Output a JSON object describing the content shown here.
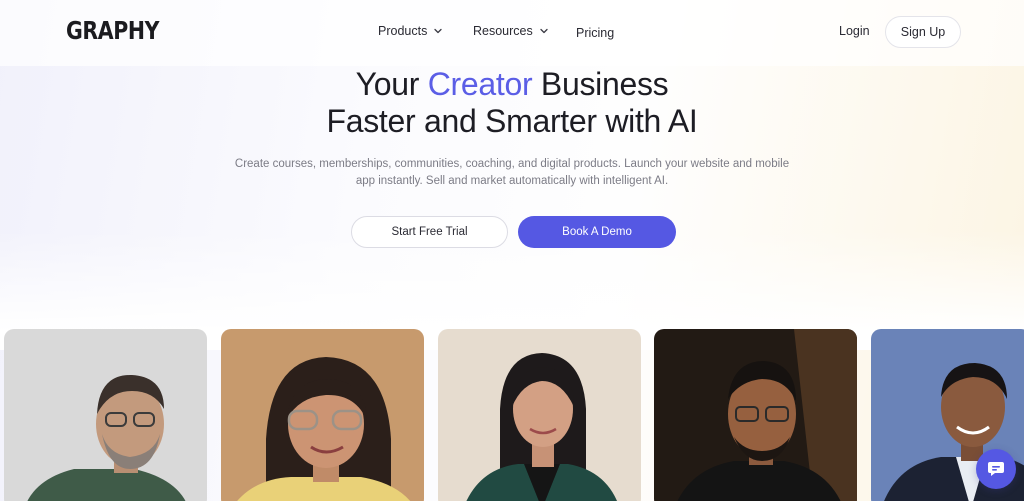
{
  "header": {
    "logo": "GRAPHY",
    "nav": {
      "products": "Products",
      "resources": "Resources",
      "pricing": "Pricing"
    },
    "login": "Login",
    "signup": "Sign Up"
  },
  "hero": {
    "title_line1_pre": "Your ",
    "title_line1_accent": "Creator",
    "title_line1_post": " Business",
    "title_line2": "Faster and Smarter with AI",
    "subtext_line1": "Create courses, memberships, communities, coaching, and digital products. Launch your website and mobile",
    "subtext_line2": "app instantly. Sell and market automatically with intelligent AI.",
    "cta_trial": "Start Free Trial",
    "cta_demo": "Book A Demo"
  },
  "colors": {
    "accent": "#5b5ee6",
    "button_primary": "#5558e3"
  },
  "icons": {
    "products_chevron": "chevron-down-icon",
    "resources_chevron": "chevron-down-icon",
    "chat": "chat-bubble-icon"
  }
}
